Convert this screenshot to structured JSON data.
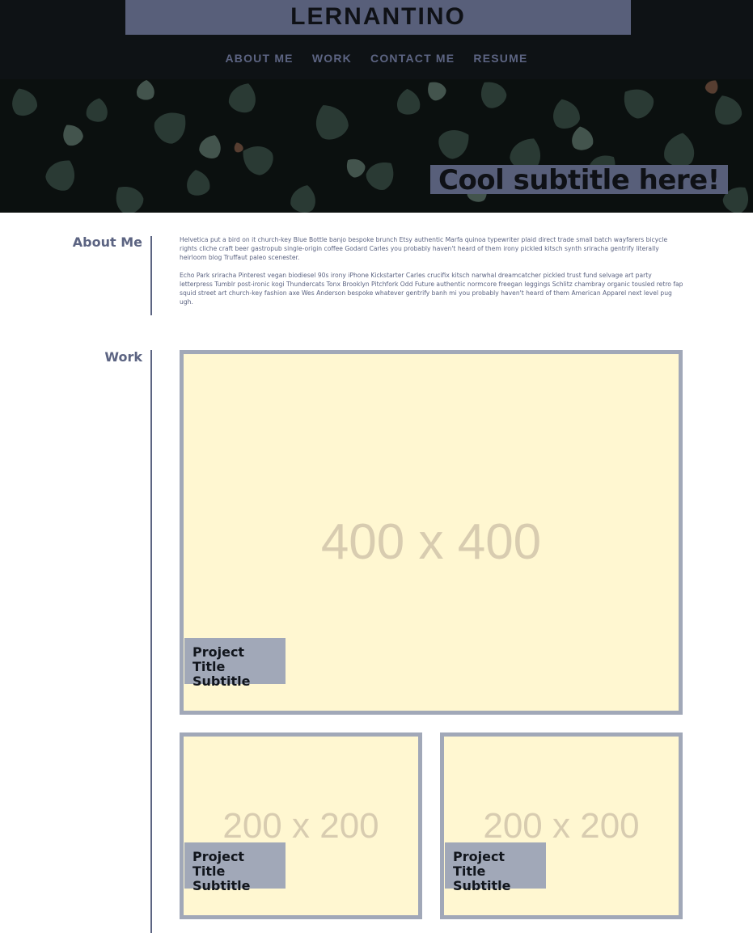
{
  "header": {
    "site_title": "LERNANTINO",
    "nav": [
      "ABOUT ME",
      "WORK",
      "CONTACT ME",
      "RESUME"
    ]
  },
  "hero": {
    "subtitle": "Cool subtitle here!"
  },
  "about": {
    "label": "About Me",
    "paragraphs": [
      "Helvetica put a bird on it church-key Blue Bottle banjo bespoke brunch Etsy authentic Marfa quinoa typewriter plaid direct trade small batch wayfarers bicycle rights cliche craft beer gastropub single-origin coffee Godard Carles you probably haven't heard of them irony pickled kitsch synth sriracha gentrify literally heirloom blog Truffaut paleo scenester.",
      "Echo Park sriracha Pinterest vegan biodiesel 90s irony iPhone Kickstarter Carles crucifix kitsch narwhal dreamcatcher pickled trust fund selvage art party letterpress Tumblr post-ironic kogi Thundercats Tonx Brooklyn Pitchfork Odd Future authentic normcore freegan leggings Schlitz chambray organic tousled retro fap squid street art church-key fashion axe Wes Anderson bespoke whatever gentrify banh mi you probably haven't heard of them American Apparel next level pug ugh."
    ]
  },
  "work": {
    "label": "Work",
    "projects": [
      {
        "placeholder": "400 x 400",
        "title": "Project Title",
        "subtitle": "Subtitle"
      },
      {
        "placeholder": "200 x 200",
        "title": "Project Title",
        "subtitle": "Subtitle"
      },
      {
        "placeholder": "200 x 200",
        "title": "Project Title",
        "subtitle": "Subtitle"
      }
    ]
  },
  "colors": {
    "header_bg": "#0e1215",
    "accent": "#585f7a",
    "text_accent": "#5c6482",
    "card_border": "#a1a8b8",
    "card_fill": "#fff7d1"
  }
}
